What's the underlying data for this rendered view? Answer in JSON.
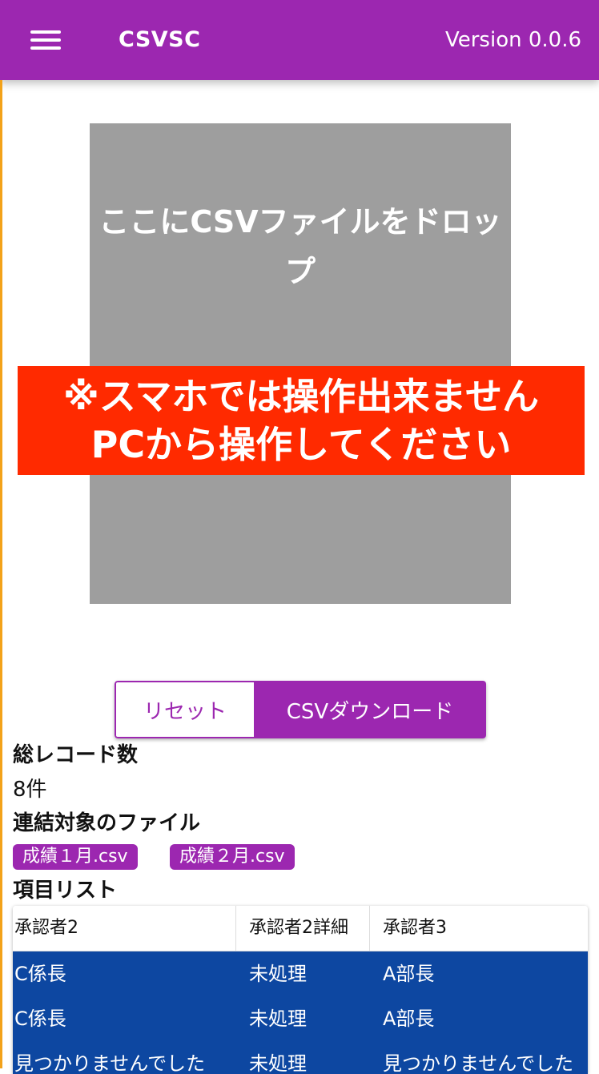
{
  "appbar": {
    "title": "CSVSC",
    "version": "Version 0.0.6",
    "menu_icon": "hamburger-menu-icon",
    "color": "#9c27b0"
  },
  "dropzone": {
    "line1": "ここにCSVファイルをドロッ",
    "line2": "プ",
    "background": "#9e9e9e"
  },
  "warning": {
    "line1": "※スマホでは操作出来ません",
    "line2": "PCから操作してください",
    "background": "#ff2a00"
  },
  "buttons": {
    "reset": "リセット",
    "download": "CSVダウンロード"
  },
  "summary": {
    "total_heading": "総レコード数",
    "total_value": "8件",
    "files_heading": "連結対象のファイル",
    "files": [
      "成績１月.csv",
      "成績２月.csv"
    ],
    "items_heading": "項目リスト"
  },
  "table": {
    "headers": [
      "承認者2",
      "承認者2詳細",
      "承認者3"
    ],
    "rows": [
      [
        "C係長",
        "未処理",
        "A部長"
      ],
      [
        "C係長",
        "未処理",
        "A部長"
      ],
      [
        "見つかりませんでした",
        "未処理",
        "見つかりませんでした"
      ]
    ],
    "row_color": "#0d47a1"
  }
}
